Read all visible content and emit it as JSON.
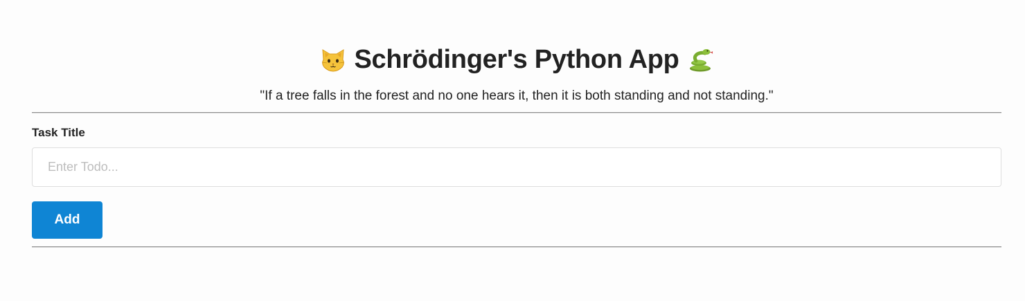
{
  "header": {
    "title": "Schrödinger's Python App",
    "title_icons": [
      "cat-face-icon",
      "snake-icon"
    ],
    "quote": "\"If a tree falls in the forest and no one hears it, then it is both standing and not standing.\""
  },
  "form": {
    "label": "Task Title",
    "input_value": "",
    "input_placeholder": "Enter Todo...",
    "add_label": "Add"
  },
  "colors": {
    "primary_button": "#0f85d4",
    "text": "#222222",
    "placeholder": "#bdbdbd"
  }
}
